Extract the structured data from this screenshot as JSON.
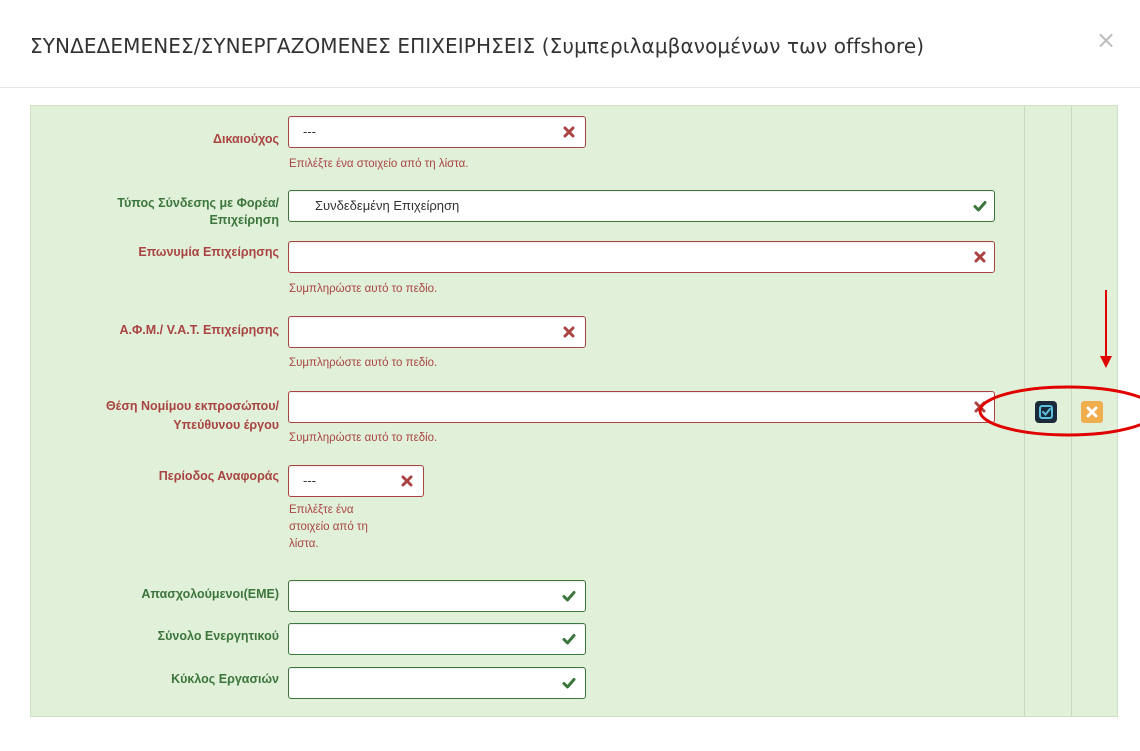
{
  "dialog": {
    "title": "ΣΥΝΔΕΔΕΜΕΝΕΣ/ΣΥΝΕΡΓΑΖΟΜΕΝΕΣ ΕΠΙΧΕΙΡΗΣΕΙΣ (Συμπεριλαμβανομένων των offshore)",
    "close_label": "×"
  },
  "fields": {
    "beneficiary": {
      "label": "Δικαιούχος",
      "value": "---",
      "help": "Επιλέξτε ένα στοιχείο από τη λίστα.",
      "status": "error"
    },
    "link_type": {
      "label_line1": "Τύπος Σύνδεσης με Φορέα/",
      "label_line2": "Επιχείρηση",
      "value": "Συνδεδεμένη Επιχείρηση",
      "status": "success"
    },
    "company_name": {
      "label": "Επωνυμία Επιχείρησης",
      "value": "",
      "help": "Συμπληρώστε αυτό το πεδίο.",
      "status": "error"
    },
    "vat": {
      "label": "Α.Φ.Μ./ V.A.T. Επιχείρησης",
      "value": "",
      "help": "Συμπληρώστε αυτό το πεδίο.",
      "status": "error"
    },
    "legal_rep": {
      "label_line1": "Θέση Νομίμου εκπροσώπου/",
      "label_line2": "Υπεύθυνου έργου",
      "value": "",
      "help": "Συμπληρώστε αυτό το πεδίο.",
      "status": "error"
    },
    "period": {
      "label": "Περίοδος Αναφοράς",
      "value": "---",
      "help_line1": "Επιλέξτε ένα",
      "help_line2": "στοιχείο από τη",
      "help_line3": "λίστα.",
      "status": "error"
    },
    "employees": {
      "label": "Απασχολούμενοι(ΕΜΕ)",
      "value": "",
      "status": "success"
    },
    "total_assets": {
      "label": "Σύνολο Ενεργητικού",
      "value": "",
      "status": "success"
    },
    "turnover": {
      "label": "Κύκλος Εργασιών",
      "value": "",
      "status": "success"
    }
  },
  "row_actions": {
    "edit_icon": "edit-check-icon",
    "delete_icon": "close-icon"
  },
  "colors": {
    "error": "#a94442",
    "success": "#3c763d",
    "panel_bg": "#e1f0d8",
    "delete_btn": "#f0ad4e",
    "edit_btn": "#1a2a3a",
    "annotation": "#e00000"
  }
}
